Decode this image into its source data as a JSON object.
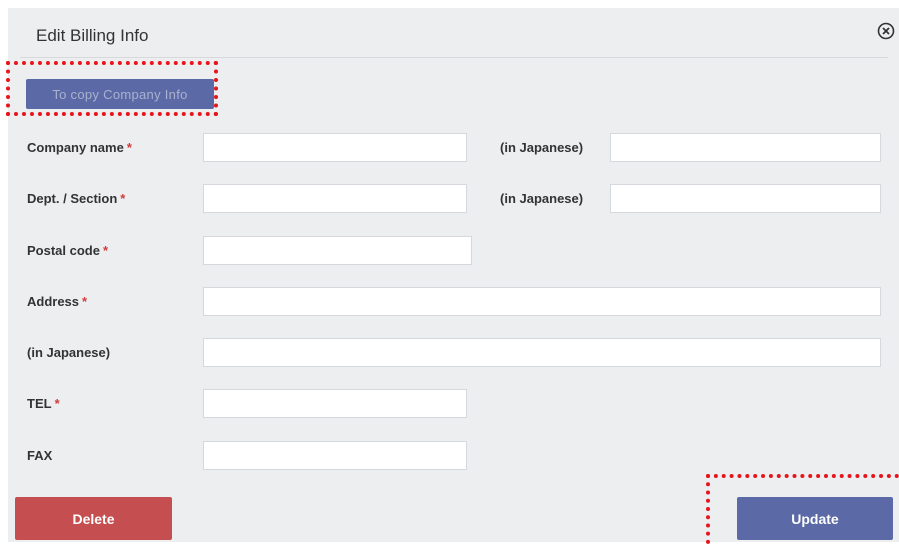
{
  "dialog": {
    "title": "Edit Billing Info",
    "close_icon": "close-circle-icon"
  },
  "copy_button": {
    "label": "To copy Company Info"
  },
  "form": {
    "required_mark": "*",
    "company_name": {
      "label": "Company name",
      "value": "",
      "jp_label": "(in Japanese)",
      "jp_value": ""
    },
    "dept_section": {
      "label": "Dept. / Section",
      "value": "",
      "jp_label": "(in Japanese)",
      "jp_value": ""
    },
    "postal_code": {
      "label": "Postal code",
      "value": ""
    },
    "address": {
      "label": "Address",
      "value": ""
    },
    "address_jp": {
      "label": "(in Japanese)",
      "value": ""
    },
    "tel": {
      "label": "TEL",
      "value": ""
    },
    "fax": {
      "label": "FAX",
      "value": ""
    }
  },
  "footer": {
    "delete_label": "Delete",
    "update_label": "Update"
  },
  "colors": {
    "primary": "#5b6aa6",
    "danger": "#c54f50",
    "highlight": "#e8141b",
    "required": "#d23b3b"
  }
}
